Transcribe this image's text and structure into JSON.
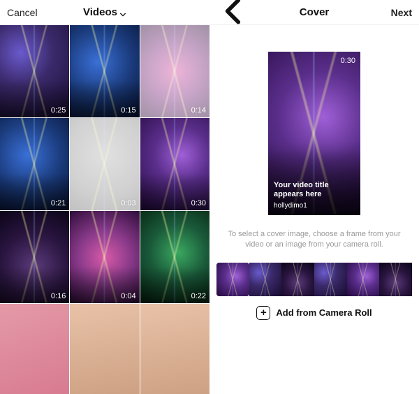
{
  "left": {
    "cancel": "Cancel",
    "title": "Videos",
    "videos": [
      {
        "dur": "0:25",
        "style": "c-purple beams vgrad",
        "faded": false
      },
      {
        "dur": "0:15",
        "style": "c-blue beams vgrad",
        "faded": false
      },
      {
        "dur": "0:14",
        "style": "c-magenta beams",
        "faded": true
      },
      {
        "dur": "0:21",
        "style": "c-blue beams vgrad",
        "faded": false
      },
      {
        "dur": "0:03",
        "style": "c-grey beams",
        "faded": true
      },
      {
        "dur": "0:30",
        "style": "c-purple2 beams vgrad",
        "faded": false
      },
      {
        "dur": "0:16",
        "style": "c-dark beams vgrad",
        "faded": false
      },
      {
        "dur": "0:04",
        "style": "c-magenta beams vgrad",
        "faded": false
      },
      {
        "dur": "0:22",
        "style": "c-green beams vgrad",
        "faded": false
      },
      {
        "dur": "",
        "style": "c-pink",
        "faded": false
      },
      {
        "dur": "",
        "style": "c-skin",
        "faded": false
      },
      {
        "dur": "",
        "style": "c-skin",
        "faded": false
      }
    ]
  },
  "right": {
    "title": "Cover",
    "next": "Next",
    "preview": {
      "dur": "0:30",
      "title_line1": "Your video title",
      "title_line2": "appears here",
      "username": "hollydimo1"
    },
    "hint": "To select a cover image, choose a frame from your video or an image from your camera roll.",
    "frames": [
      {
        "style": "c-purple2 beams",
        "selected": true
      },
      {
        "style": "c-purple beams",
        "selected": false
      },
      {
        "style": "c-dark beams",
        "selected": false
      },
      {
        "style": "c-purple beams",
        "selected": false
      },
      {
        "style": "c-purple2 beams",
        "selected": false
      },
      {
        "style": "c-dark beams",
        "selected": false
      }
    ],
    "add_label": "Add from Camera Roll"
  }
}
